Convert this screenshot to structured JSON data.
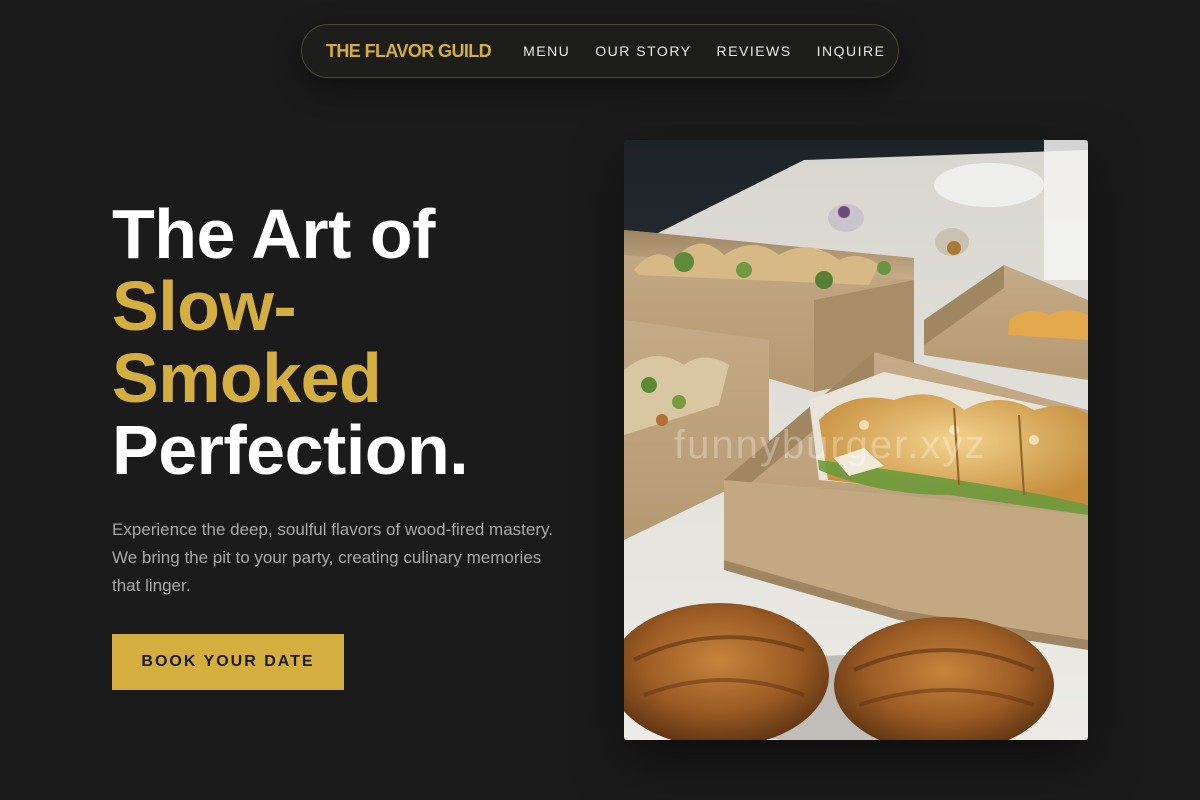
{
  "nav": {
    "brand": "THE FLAVOR GUILD",
    "links": [
      "MENU",
      "OUR STORY",
      "REVIEWS",
      "INQUIRE"
    ]
  },
  "hero": {
    "headline_line1": "The Art of",
    "headline_accent1": "Slow-",
    "headline_accent2": "Smoked",
    "headline_line4": "Perfection.",
    "lead": "Experience the deep, soulful flavors of wood-fired mastery. We bring the pit to your party, creating culinary memories that linger.",
    "cta_label": "BOOK YOUR DATE"
  },
  "image": {
    "watermark": "funnyburger.xyz"
  },
  "colors": {
    "background": "#1b1b1b",
    "accent": "#d4af3f",
    "text": "#ffffff",
    "muted": "#a8a8a8"
  }
}
